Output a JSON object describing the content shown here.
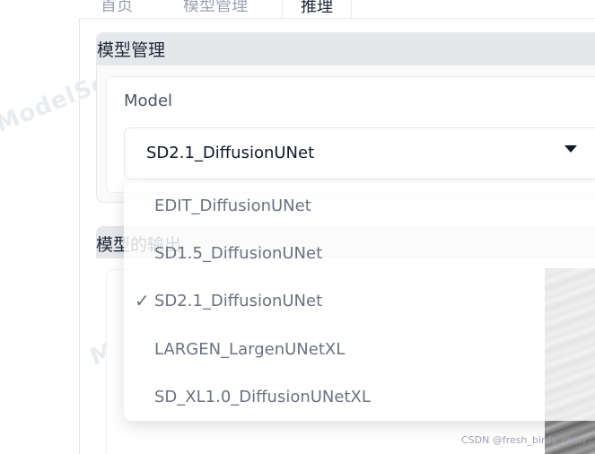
{
  "tabs": [
    {
      "label": "首页",
      "active": false
    },
    {
      "label": "模型管理",
      "active": false
    },
    {
      "label": "推理",
      "active": true
    }
  ],
  "model_management": {
    "header": "模型管理",
    "model_label": "Model",
    "selected_value": "SD2.1_DiffusionUNet",
    "options": [
      {
        "label": "EDIT_DiffusionUNet",
        "checked": false
      },
      {
        "label": "SD1.5_DiffusionUNet",
        "checked": false
      },
      {
        "label": "SD2.1_DiffusionUNet",
        "checked": true
      },
      {
        "label": "LARGEN_LargenUNetXL",
        "checked": false
      },
      {
        "label": "SD_XL1.0_DiffusionUNetXL",
        "checked": false
      }
    ],
    "check_glyph": "✓"
  },
  "output": {
    "header": "模型的输出"
  },
  "watermark_text": "ModelScope",
  "footer_credit": "CSDN @fresh_birds_chen"
}
